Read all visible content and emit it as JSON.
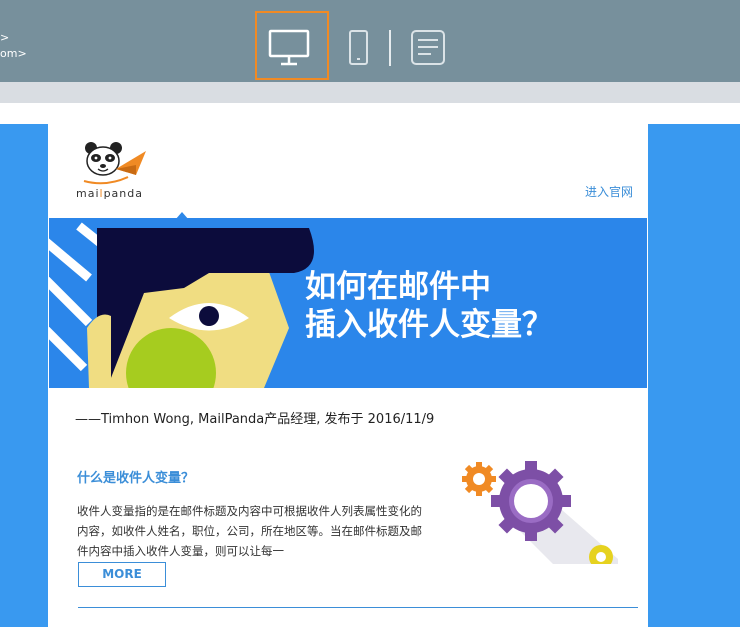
{
  "toolbar": {
    "from_lines": [
      ">",
      "om>"
    ],
    "devices": [
      {
        "name": "desktop",
        "icon": "monitor-icon",
        "selected": true
      },
      {
        "name": "mobile",
        "icon": "phone-icon",
        "selected": false
      },
      {
        "name": "text",
        "icon": "document-icon",
        "selected": false
      }
    ],
    "accent_color": "#f08a24"
  },
  "email": {
    "brand": {
      "pre": "mai",
      "hl": "l",
      "post": "panda"
    },
    "site_link": "进入官网",
    "banner": {
      "title_line1": "如何在邮件中",
      "title_line2": "插入收件人变量？"
    },
    "byline": "——Timhon Wong, MailPanda产品经理, 发布于 2016/11/9",
    "section_title": "什么是收件人变量？",
    "section_body": "收件人变量指的是在邮件标题及内容中可根据收件人列表属性变化的内容，如收件人姓名，职位，公司，所在地区等。当在邮件标题及邮件内容中插入收件人变量，则可以让每一",
    "more_label": "MORE"
  },
  "colors": {
    "toolbar_bg": "#77909c",
    "email_bg": "#3999f0",
    "link": "#3b8ed8"
  }
}
